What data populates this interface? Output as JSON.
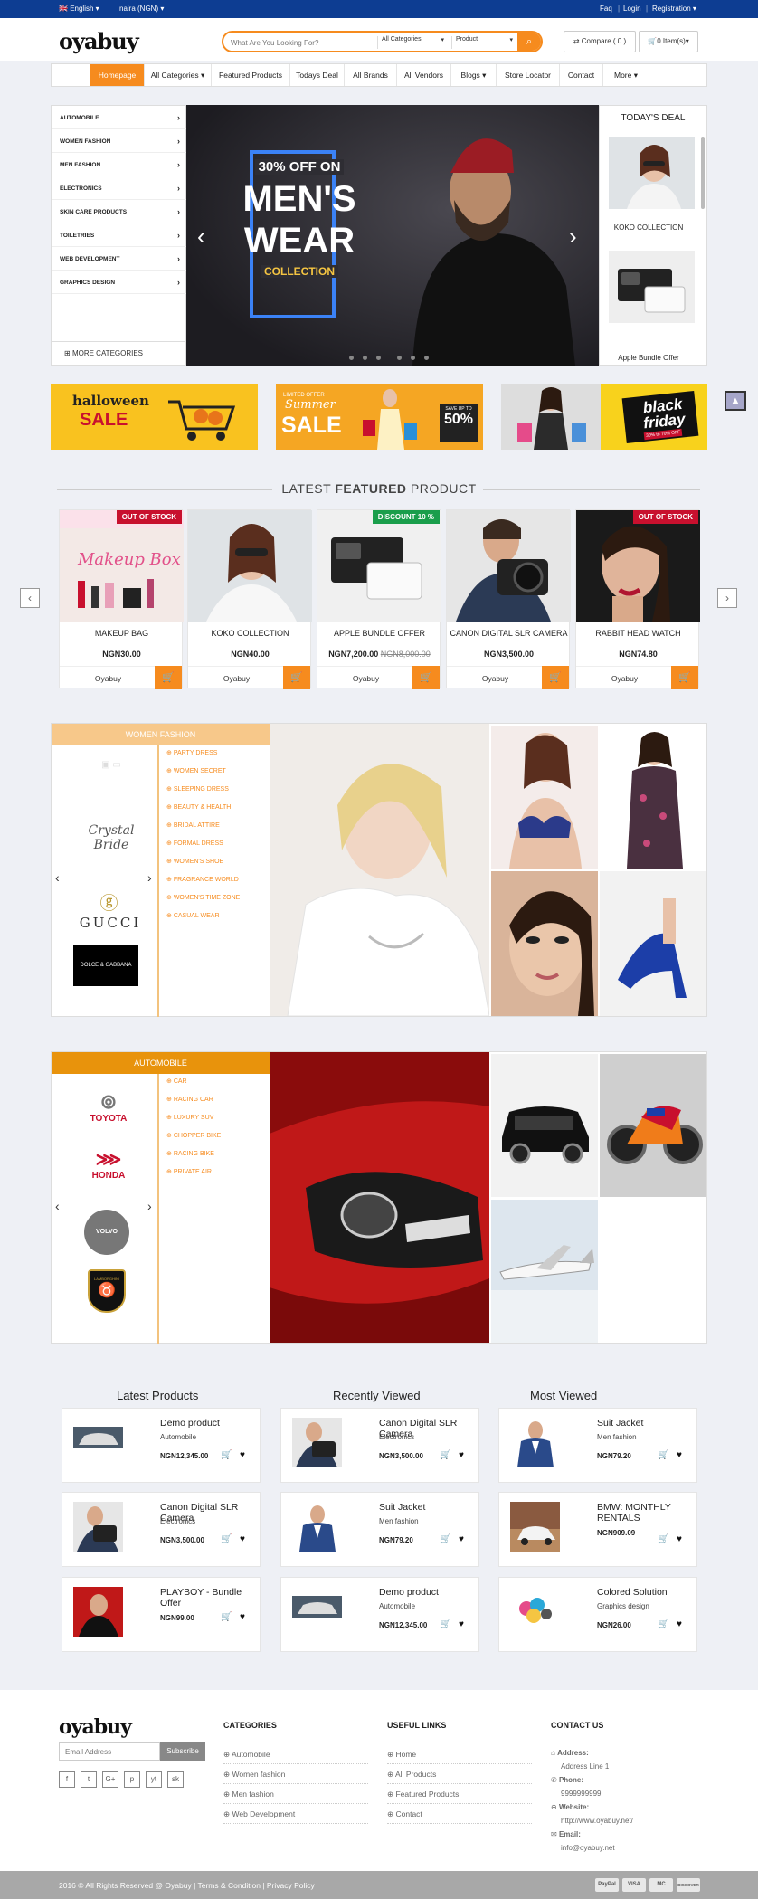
{
  "topbar": {
    "language": "English",
    "currency": "naira (NGN)",
    "faq": "Faq",
    "login": "Login",
    "registration": "Registration",
    "bg": "#0d3d92"
  },
  "header": {
    "logo": "oyabuy",
    "search_placeholder": "What Are You Looking For?",
    "category_select": "All Categories",
    "type_select": "Product",
    "compare": "Compare ( 0 )",
    "cart": "0 Item(s)",
    "accent": "#f68b1e"
  },
  "nav": [
    "Homepage",
    "All Categories",
    "Featured Products",
    "Todays Deal",
    "All Brands",
    "All Vendors",
    "Blogs",
    "Store Locator",
    "Contact",
    "More"
  ],
  "sidebar": {
    "categories": [
      "AUTOMOBILE",
      "WOMEN FASHION",
      "MEN FASHION",
      "ELECTRONICS",
      "SKIN CARE PRODUCTS",
      "TOILETRIES",
      "WEB DEVELOPMENT",
      "GRAPHICS DESIGN"
    ],
    "more": "MORE CATEGORIES"
  },
  "slider": {
    "line1": "30% OFF ON",
    "line2": "MEN'S",
    "line3": "WEAR",
    "line4": "COLLECTION"
  },
  "todays_deal": {
    "title": "TODAY'S DEAL",
    "items": [
      "KOKO COLLECTION",
      "Apple Bundle Offer"
    ]
  },
  "banners": {
    "b1": {
      "title": "halloween",
      "sub": "SALE"
    },
    "b2": {
      "tag": "LIMITED OFFER",
      "title": "Summer",
      "sub": "SALE",
      "pct": "50%",
      "upto": "SAVE UP TO"
    },
    "b3": {
      "title": "black friday",
      "sub": "30% to 70% OFF"
    }
  },
  "featured": {
    "title_pre": "LATEST ",
    "title_bold": "FEATURED",
    "title_post": " PRODUCT",
    "products": [
      {
        "name": "MAKEUP BAG",
        "price": "NGN30.00",
        "old": "",
        "badge": "OUT OF STOCK",
        "badge_color": "#c8102e",
        "vendor": "Oyabuy"
      },
      {
        "name": "KOKO COLLECTION",
        "price": "NGN40.00",
        "old": "",
        "badge": "",
        "badge_color": "",
        "vendor": "Oyabuy"
      },
      {
        "name": "APPLE BUNDLE OFFER",
        "price": "NGN7,200.00",
        "old": "NGN8,000.00",
        "badge": "DISCOUNT 10 %",
        "badge_color": "#1a9e4b",
        "vendor": "Oyabuy"
      },
      {
        "name": "CANON DIGITAL SLR CAMERA",
        "price": "NGN3,500.00",
        "old": "",
        "badge": "",
        "badge_color": "",
        "vendor": "Oyabuy"
      },
      {
        "name": "RABBIT HEAD WATCH",
        "price": "NGN74.80",
        "old": "",
        "badge": "OUT OF STOCK",
        "badge_color": "#c8102e",
        "vendor": "Oyabuy"
      }
    ]
  },
  "women_fashion": {
    "title": "WOMEN FASHION",
    "links": [
      "PARTY DRESS",
      "WOMEN SECRET",
      "SLEEPING DRESS",
      "BEAUTY & HEALTH",
      "BRIDAL ATTIRE",
      "FORMAL DRESS",
      "WOMEN'S SHOE",
      "FRAGRANCE WORLD",
      "WOMEN'S TIME ZONE",
      "CASUAL WEAR"
    ],
    "brands": [
      "Crystal Bride",
      "GUCCI",
      "DOLCE & GABBANA"
    ],
    "head_color": "#f7c88a"
  },
  "automobile": {
    "title": "AUTOMOBILE",
    "links": [
      "CAR",
      "RACING CAR",
      "LUXURY SUV",
      "CHOPPER BIKE",
      "RACING BIKE",
      "PRIVATE AIR"
    ],
    "brands": [
      "TOYOTA",
      "HONDA",
      "VOLVO",
      "LAMBORGHINI"
    ],
    "head_color": "#e8930c"
  },
  "lists": {
    "latest": {
      "title": "Latest Products",
      "items": [
        {
          "name": "Demo product",
          "cat": "Automobile",
          "price": "NGN12,345.00"
        },
        {
          "name": "Canon Digital SLR Camera",
          "cat": "Electronics",
          "price": "NGN3,500.00"
        },
        {
          "name": "PLAYBOY - Bundle Offer",
          "cat": "",
          "price": "NGN99.00"
        }
      ]
    },
    "recent": {
      "title": "Recently Viewed",
      "items": [
        {
          "name": "Canon Digital SLR Camera",
          "cat": "Electronics",
          "price": "NGN3,500.00"
        },
        {
          "name": "Suit Jacket",
          "cat": "Men fashion",
          "price": "NGN79.20"
        },
        {
          "name": "Demo product",
          "cat": "Automobile",
          "price": "NGN12,345.00"
        }
      ]
    },
    "most": {
      "title": "Most Viewed",
      "items": [
        {
          "name": "Suit Jacket",
          "cat": "Men fashion",
          "price": "NGN79.20"
        },
        {
          "name": "BMW: MONTHLY RENTALS",
          "cat": "",
          "price": "NGN909.09"
        },
        {
          "name": "Colored Solution",
          "cat": "Graphics design",
          "price": "NGN26.00"
        }
      ]
    }
  },
  "footer": {
    "logo": "oyabuy",
    "email_placeholder": "Email Address",
    "subscribe": "Subscribe",
    "social": [
      "f",
      "t",
      "G+",
      "p",
      "yt",
      "sk"
    ],
    "categories_title": "CATEGORIES",
    "categories": [
      "Automobile",
      "Women fashion",
      "Men fashion",
      "Web Development"
    ],
    "links_title": "USEFUL LINKS",
    "links": [
      "Home",
      "All Products",
      "Featured Products",
      "Contact"
    ],
    "contact_title": "CONTACT US",
    "address_label": "Address:",
    "address": "Address Line 1",
    "phone_label": "Phone:",
    "phone": "9999999999",
    "website_label": "Website:",
    "website": "http://www.oyabuy.net/",
    "email_label": "Email:",
    "email": "info@oyabuy.net"
  },
  "bottom": {
    "copy": "2016 © All Rights Reserved @ Oyabuy | Terms & Condition | Privacy Policy",
    "payments": [
      "PayPal",
      "VISA",
      "MC",
      "DISCOVER"
    ]
  }
}
